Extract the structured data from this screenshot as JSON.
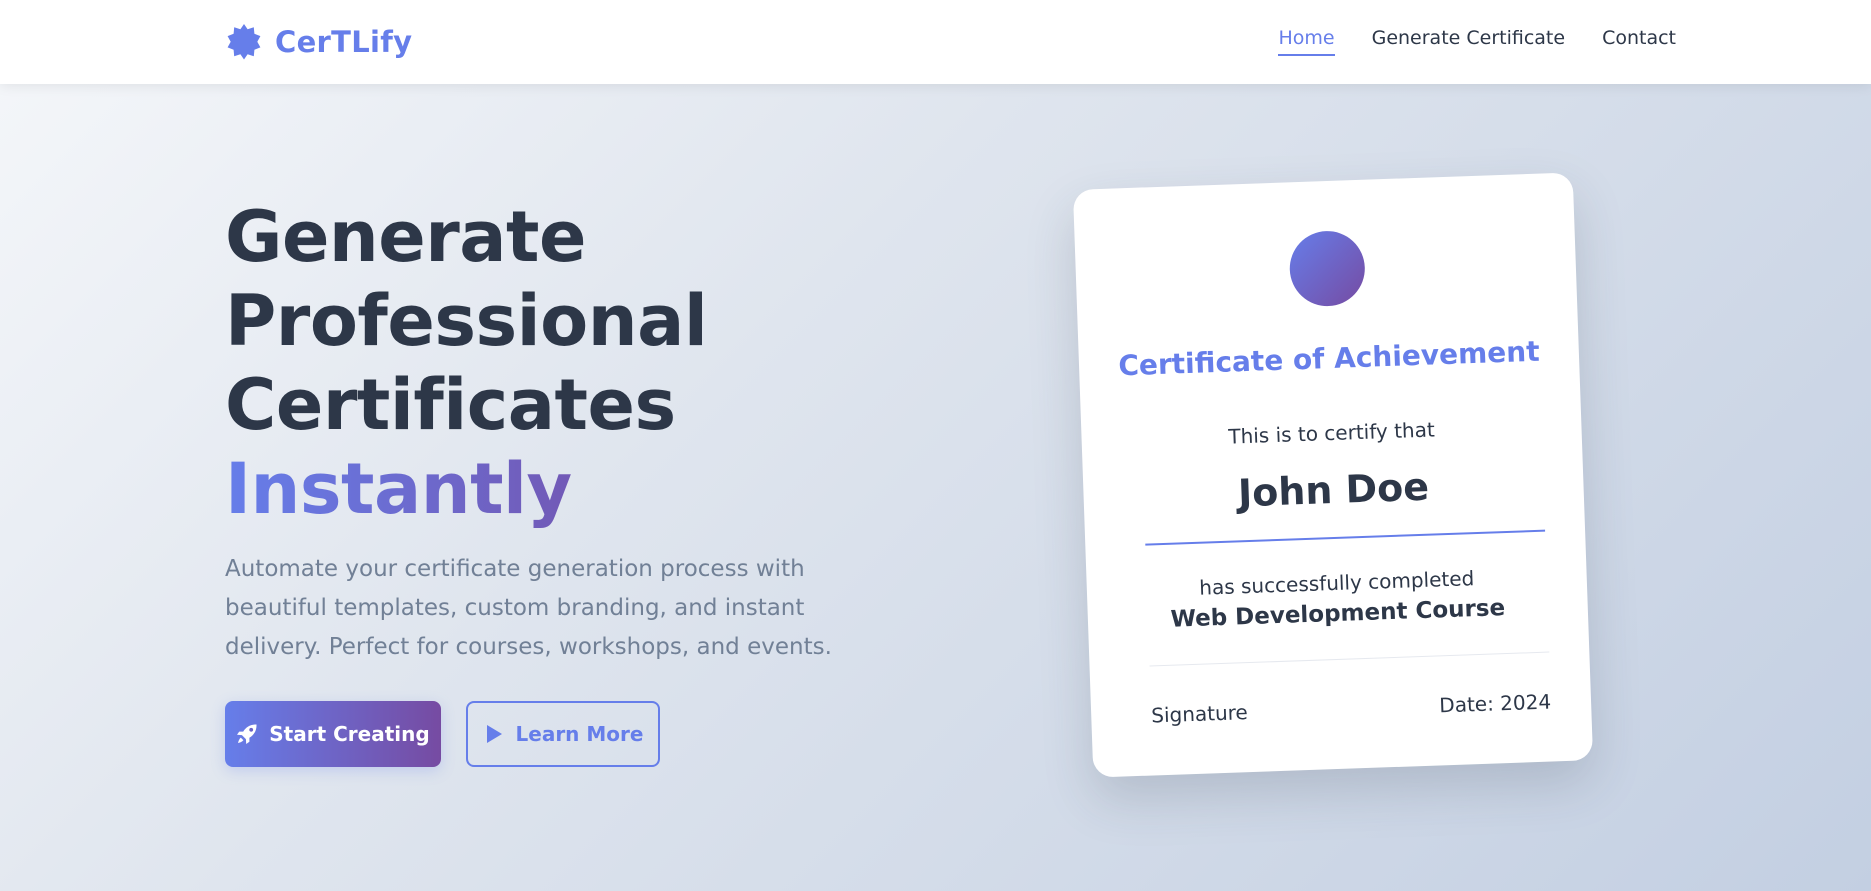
{
  "nav": {
    "brand": "CerTLify",
    "links": [
      {
        "label": "Home",
        "active": true
      },
      {
        "label": "Generate Certificate",
        "active": false
      },
      {
        "label": "Contact",
        "active": false
      }
    ]
  },
  "hero": {
    "title_lines": [
      "Generate",
      "Professional",
      "Certificates"
    ],
    "title_highlight": "Instantly",
    "description": "Automate your certificate generation process with beautiful templates, custom branding, and instant delivery. Perfect for courses, workshops, and events.",
    "primary_button": {
      "label": "Start Creating",
      "icon": "rocket-icon"
    },
    "secondary_button": {
      "label": "Learn More",
      "icon": "play-icon"
    }
  },
  "certificate": {
    "title": "Certificate of Achievement",
    "intro": "This is to certify that",
    "recipient": "John Doe",
    "completed_text": "has successfully completed",
    "course": "Web Development Course",
    "signature_label": "Signature",
    "date_label": "Date: 2024"
  },
  "colors": {
    "accent": "#667eea",
    "accent_end": "#764ba2",
    "text_dark": "#2d3748",
    "text_muted": "#718096",
    "background_start": "#f5f7fa",
    "background_end": "#c3cfe2"
  }
}
